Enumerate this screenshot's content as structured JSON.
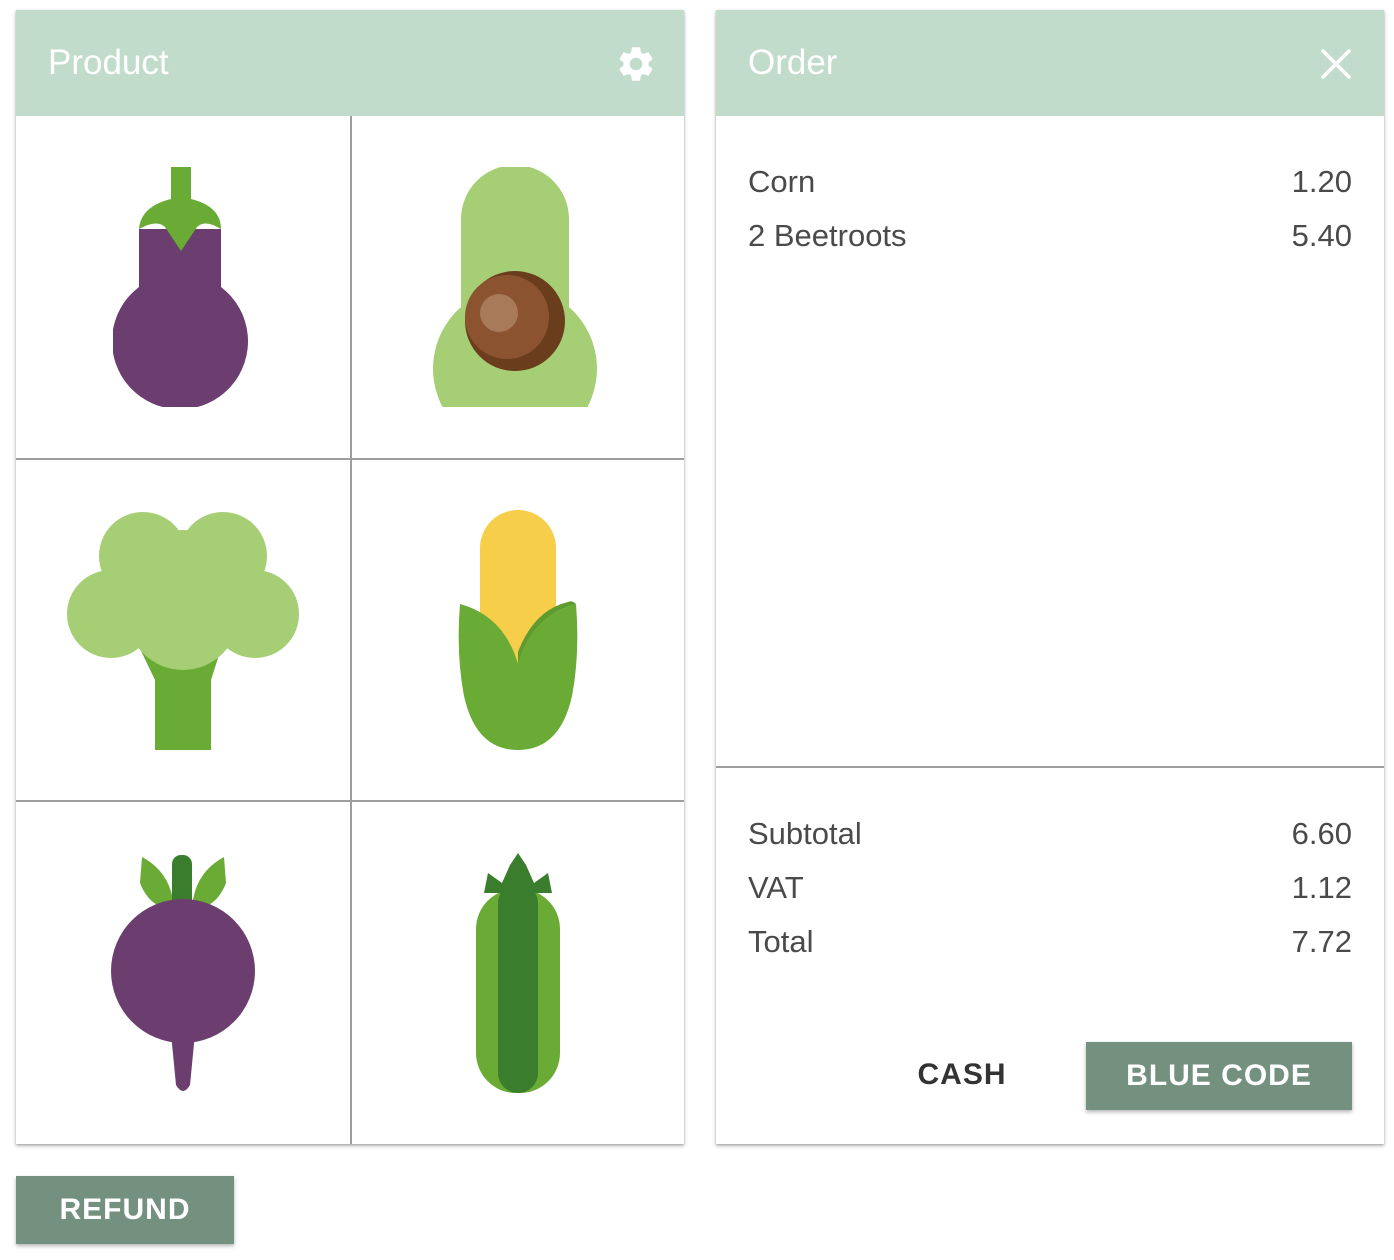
{
  "product_panel": {
    "title": "Product",
    "settings_icon": "gear-icon",
    "products": [
      {
        "icon": "eggplant-icon"
      },
      {
        "icon": "avocado-icon"
      },
      {
        "icon": "broccoli-icon"
      },
      {
        "icon": "corn-icon"
      },
      {
        "icon": "beetroot-icon"
      },
      {
        "icon": "cucumber-icon"
      }
    ]
  },
  "order_panel": {
    "title": "Order",
    "close_icon": "close-icon",
    "items": [
      {
        "label": "Corn",
        "price": "1.20"
      },
      {
        "label": "2 Beetroots",
        "price": "5.40"
      }
    ],
    "totals": {
      "subtotal_label": "Subtotal",
      "subtotal": "6.60",
      "vat_label": "VAT",
      "vat": "1.12",
      "total_label": "Total",
      "total": "7.72"
    },
    "buttons": {
      "cash": "CASH",
      "blue_code": "BLUE CODE"
    }
  },
  "refund_button": "REFUND",
  "colors": {
    "header_bg": "#c1dccb",
    "button_bg": "#74907f",
    "text": "#4a4a4a",
    "grid_line": "#9e9e9e"
  }
}
